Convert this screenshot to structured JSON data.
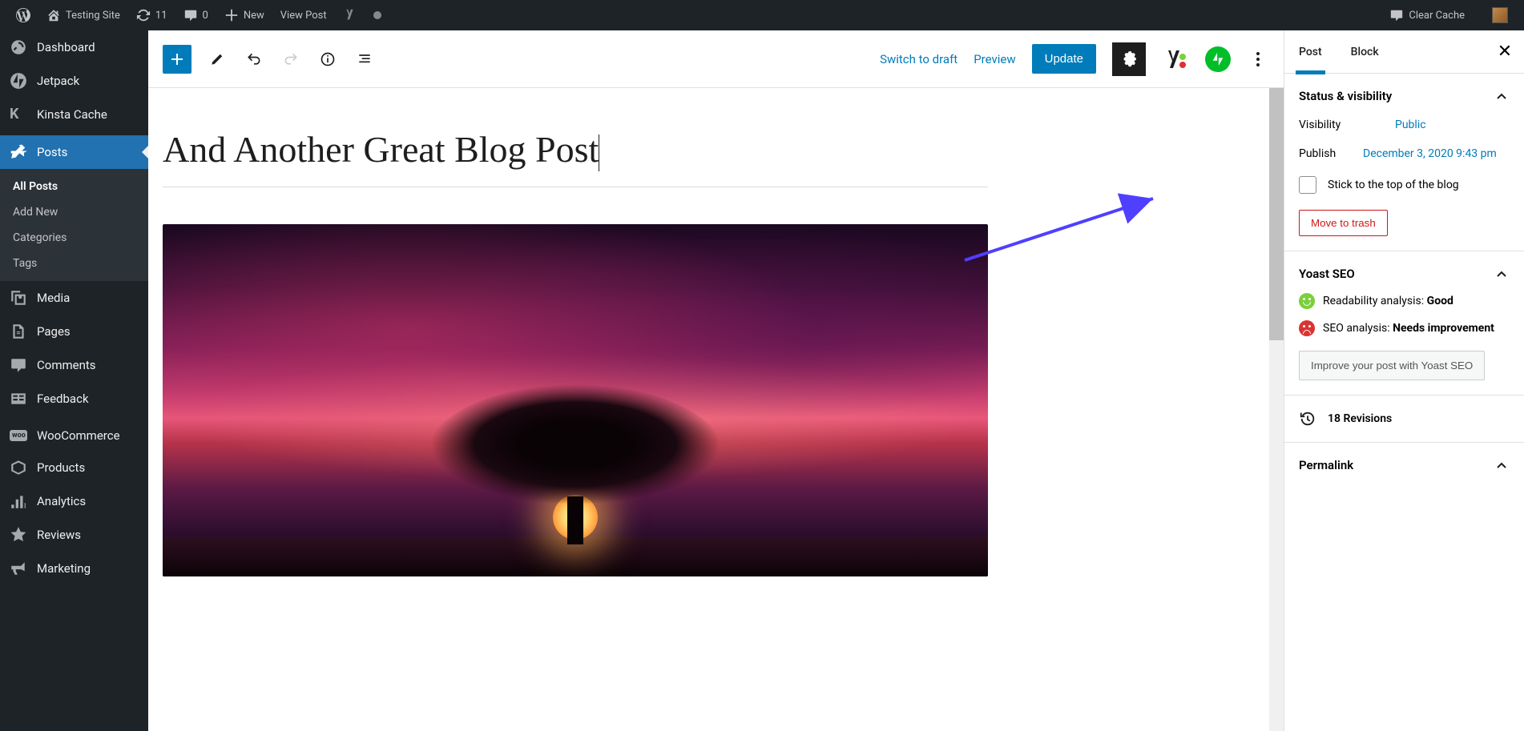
{
  "adminbar": {
    "site_name": "Testing Site",
    "updates_count": "11",
    "comments_count": "0",
    "new_label": "New",
    "view_post": "View Post",
    "clear_cache": "Clear Cache"
  },
  "sidebar": {
    "items": [
      {
        "label": "Dashboard",
        "icon": "dashboard"
      },
      {
        "label": "Jetpack",
        "icon": "jetpack"
      },
      {
        "label": "Kinsta Cache",
        "icon": "kinsta"
      },
      {
        "label": "Posts",
        "icon": "pin",
        "active": true
      },
      {
        "label": "Media",
        "icon": "media"
      },
      {
        "label": "Pages",
        "icon": "pages"
      },
      {
        "label": "Comments",
        "icon": "comments"
      },
      {
        "label": "Feedback",
        "icon": "feedback"
      },
      {
        "label": "WooCommerce",
        "icon": "woo"
      },
      {
        "label": "Products",
        "icon": "products"
      },
      {
        "label": "Analytics",
        "icon": "analytics"
      },
      {
        "label": "Reviews",
        "icon": "star"
      },
      {
        "label": "Marketing",
        "icon": "megaphone"
      }
    ],
    "posts_sub": [
      {
        "label": "All Posts",
        "active": true
      },
      {
        "label": "Add New"
      },
      {
        "label": "Categories"
      },
      {
        "label": "Tags"
      }
    ]
  },
  "editor": {
    "switch_to_draft": "Switch to draft",
    "preview": "Preview",
    "update": "Update",
    "post_title": "And Another Great Blog Post"
  },
  "settings": {
    "tabs": {
      "post": "Post",
      "block": "Block"
    },
    "status": {
      "title": "Status & visibility",
      "visibility_label": "Visibility",
      "visibility_value": "Public",
      "publish_label": "Publish",
      "publish_value": "December 3, 2020 9:43 pm",
      "sticky_label": "Stick to the top of the blog",
      "trash": "Move to trash"
    },
    "yoast": {
      "title": "Yoast SEO",
      "readability_label": "Readability analysis:",
      "readability_value": "Good",
      "seo_label": "SEO analysis:",
      "seo_value": "Needs improvement",
      "improve_btn": "Improve your post with Yoast SEO"
    },
    "revisions": "18 Revisions",
    "permalink": "Permalink"
  }
}
